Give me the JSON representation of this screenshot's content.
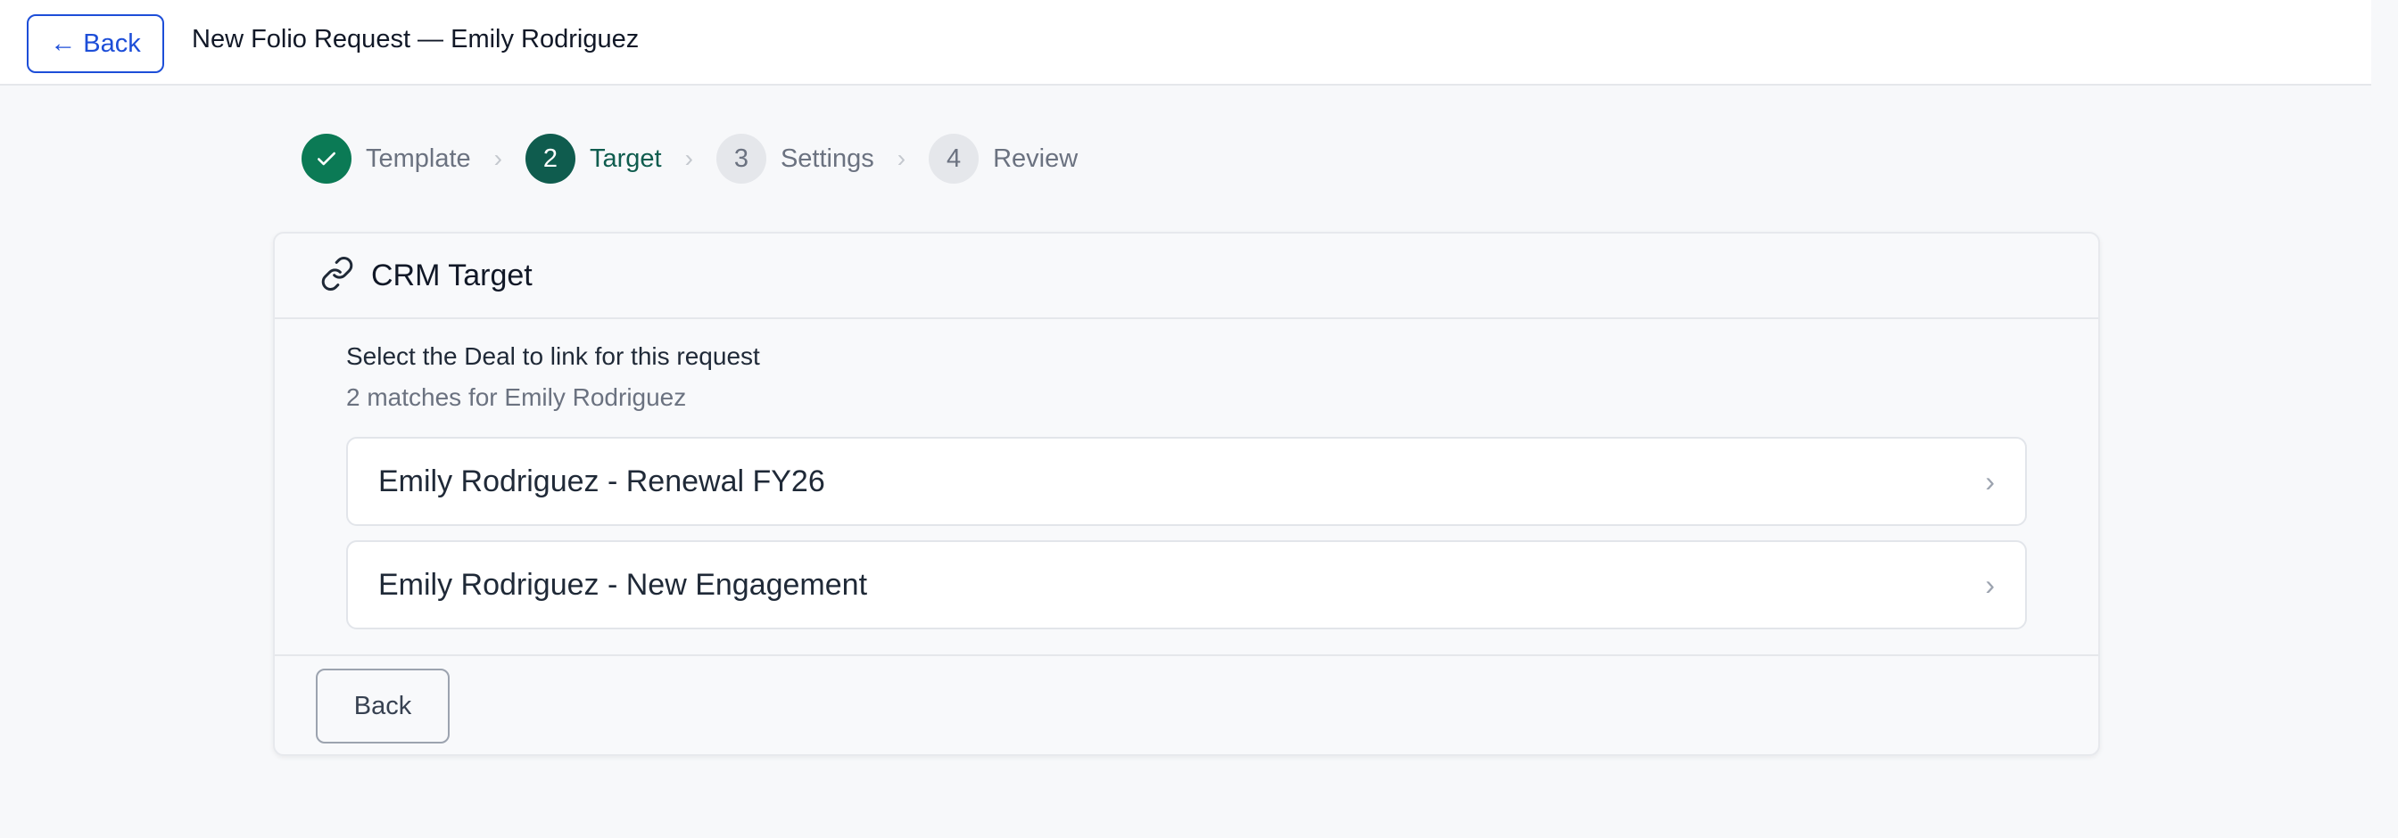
{
  "topbar": {
    "back_label": "← Back",
    "title": "New Folio Request — Emily Rodriguez"
  },
  "stepper": {
    "steps": [
      {
        "number": "1",
        "label": "Template",
        "state": "done"
      },
      {
        "number": "2",
        "label": "Target",
        "state": "current"
      },
      {
        "number": "3",
        "label": "Settings",
        "state": "pending"
      },
      {
        "number": "4",
        "label": "Review",
        "state": "pending"
      }
    ]
  },
  "card": {
    "title": "CRM Target",
    "prompt": "Select the Deal to link for this request",
    "matches": "2 matches for Emily Rodriguez",
    "deals": [
      {
        "name": "Emily Rodriguez - Renewal FY26"
      },
      {
        "name": "Emily Rodriguez - New Engagement"
      }
    ],
    "back_label": "Back"
  },
  "colors": {
    "done": "#0b7a55",
    "current": "#0f5c4e",
    "link_blue": "#1d4ed8"
  }
}
